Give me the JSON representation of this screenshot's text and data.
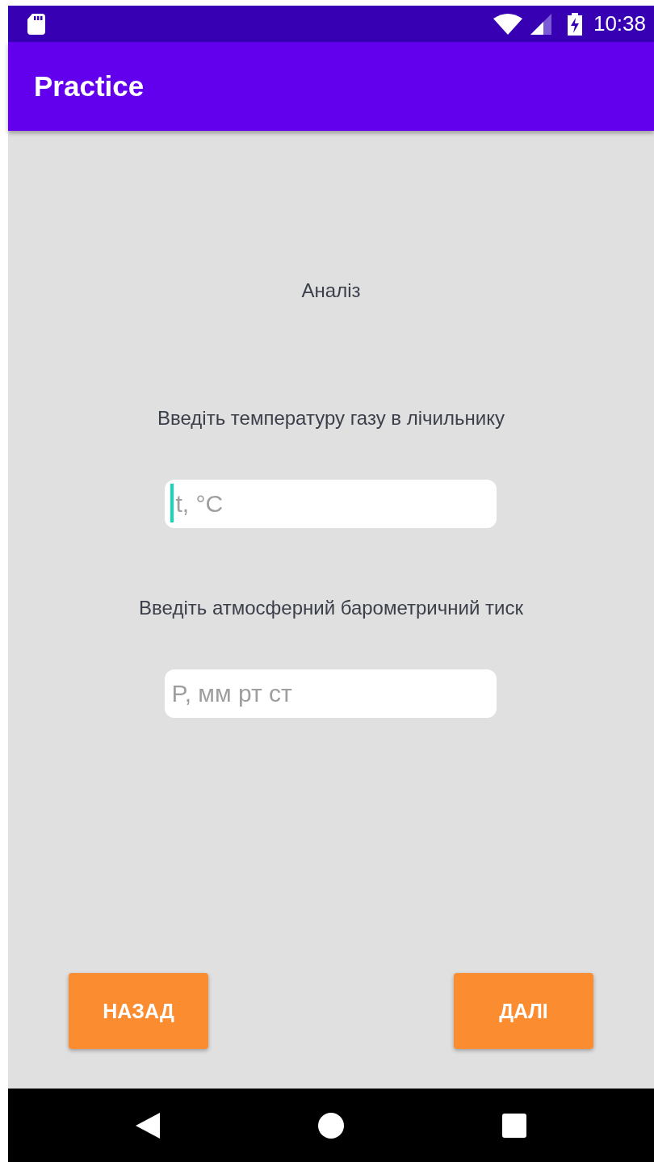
{
  "status_bar": {
    "time": "10:38"
  },
  "app_bar": {
    "title": "Practice"
  },
  "heading": "Аналіз",
  "fields": [
    {
      "label": "Введіть температуру газу в лічильнику",
      "placeholder": "t, °C",
      "focused": true
    },
    {
      "label": "Введіть атмосферний барометричний тиск",
      "placeholder": "P, мм рт ст",
      "focused": false
    }
  ],
  "buttons": [
    {
      "label": "НАЗАД"
    },
    {
      "label": "ДАЛІ"
    }
  ]
}
